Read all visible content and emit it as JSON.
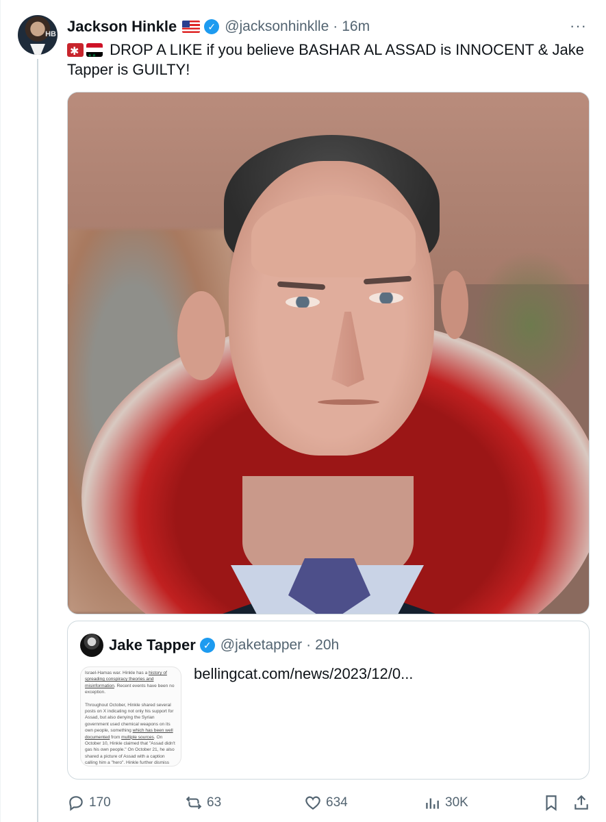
{
  "tweet": {
    "author_name": "Jackson Hinkle",
    "author_flag_icon": "us-flag-icon",
    "author_handle": "@jacksonhinklle",
    "separator": "·",
    "time": "16m",
    "more_label": "···",
    "avatar_badge": "HB",
    "text": "DROP A LIKE if you believe BASHAR AL ASSAD is INNOCENT & Jake Tapper is GUILTY!",
    "emoji_icons": [
      "kremlin-tower-icon",
      "syria-flag-icon"
    ]
  },
  "quoted_tweet": {
    "author_name": "Jake Tapper",
    "author_handle": "@jaketapper",
    "separator": "·",
    "time": "20h",
    "link_text": "bellingcat.com/news/2023/12/0...",
    "thumbnail": {
      "paragraph1_pre": "Israel-Hamas war. Hinkle has a ",
      "paragraph1_link": "history of spreading conspiracy theories and misinformation",
      "paragraph1_post": ". Recent events have been no exception.",
      "paragraph2_pre": "Throughout October, Hinkle shared several posts on X indicating not only his support for Assad, but also denying the Syrian government used chemical weapons on its own people, something ",
      "paragraph2_link1": "which has been well documented",
      "paragraph2_mid": " from ",
      "paragraph2_link2": "multiple sources",
      "paragraph2_post": ". On October 10, Hinkle claimed that \"Assad didn't gas his own people.\" On October 21, he also shared a picture of Assad with a caption calling him a \"hero\". Hinkle further dismiss"
    }
  },
  "actions": {
    "reply_count": "170",
    "repost_count": "63",
    "like_count": "634",
    "views_count": "30K"
  },
  "colors": {
    "verified": "#1d9bf0",
    "muted_text": "#536471",
    "border": "#cfd9de"
  }
}
